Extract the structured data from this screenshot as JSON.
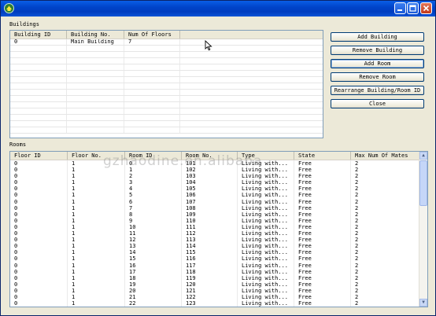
{
  "window": {
    "title": ""
  },
  "buildings": {
    "label": "Buildings",
    "columns": [
      "Building ID",
      "Building No.",
      "Num Of Floors"
    ],
    "rows": [
      [
        "0",
        "Main Building",
        "7"
      ]
    ]
  },
  "buttons": {
    "add_building": "Add Building",
    "remove_building": "Remove Building",
    "add_room": "Add Room",
    "remove_room": "Remove Room",
    "rearrange": "Rearrange Building/Room ID",
    "close": "Close"
  },
  "rooms": {
    "label": "Rooms",
    "columns": [
      "Floor ID",
      "Floor No.",
      "Room ID",
      "Room No.",
      "Type",
      "State",
      "Max Num Of Mates"
    ],
    "rows": [
      [
        "0",
        "1",
        "0",
        "101",
        "Living with...",
        "Free",
        "2"
      ],
      [
        "0",
        "1",
        "1",
        "102",
        "Living with...",
        "Free",
        "2"
      ],
      [
        "0",
        "1",
        "2",
        "103",
        "Living with...",
        "Free",
        "2"
      ],
      [
        "0",
        "1",
        "3",
        "104",
        "Living with...",
        "Free",
        "2"
      ],
      [
        "0",
        "1",
        "4",
        "105",
        "Living with...",
        "Free",
        "2"
      ],
      [
        "0",
        "1",
        "5",
        "106",
        "Living with...",
        "Free",
        "2"
      ],
      [
        "0",
        "1",
        "6",
        "107",
        "Living with...",
        "Free",
        "2"
      ],
      [
        "0",
        "1",
        "7",
        "108",
        "Living with...",
        "Free",
        "2"
      ],
      [
        "0",
        "1",
        "8",
        "109",
        "Living with...",
        "Free",
        "2"
      ],
      [
        "0",
        "1",
        "9",
        "110",
        "Living with...",
        "Free",
        "2"
      ],
      [
        "0",
        "1",
        "10",
        "111",
        "Living with...",
        "Free",
        "2"
      ],
      [
        "0",
        "1",
        "11",
        "112",
        "Living with...",
        "Free",
        "2"
      ],
      [
        "0",
        "1",
        "12",
        "113",
        "Living with...",
        "Free",
        "2"
      ],
      [
        "0",
        "1",
        "13",
        "114",
        "Living with...",
        "Free",
        "2"
      ],
      [
        "0",
        "1",
        "14",
        "115",
        "Living with...",
        "Free",
        "2"
      ],
      [
        "0",
        "1",
        "15",
        "116",
        "Living with...",
        "Free",
        "2"
      ],
      [
        "0",
        "1",
        "16",
        "117",
        "Living with...",
        "Free",
        "2"
      ],
      [
        "0",
        "1",
        "17",
        "118",
        "Living with...",
        "Free",
        "2"
      ],
      [
        "0",
        "1",
        "18",
        "119",
        "Living with...",
        "Free",
        "2"
      ],
      [
        "0",
        "1",
        "19",
        "120",
        "Living with...",
        "Free",
        "2"
      ],
      [
        "0",
        "1",
        "20",
        "121",
        "Living with...",
        "Free",
        "2"
      ],
      [
        "0",
        "1",
        "21",
        "122",
        "Living with...",
        "Free",
        "2"
      ],
      [
        "0",
        "1",
        "22",
        "123",
        "Living with...",
        "Free",
        "2"
      ]
    ]
  },
  "watermark": "gzhaodine.en.alibaba",
  "colors": {
    "titlebar": "#0044c9",
    "window_bg": "#ece9d8",
    "grid_border": "#7f9db9"
  },
  "icons": {
    "app": "app-icon",
    "minimize": "minimize-icon",
    "maximize": "maximize-icon",
    "close": "close-icon",
    "cursor": "mouse-cursor-icon"
  }
}
